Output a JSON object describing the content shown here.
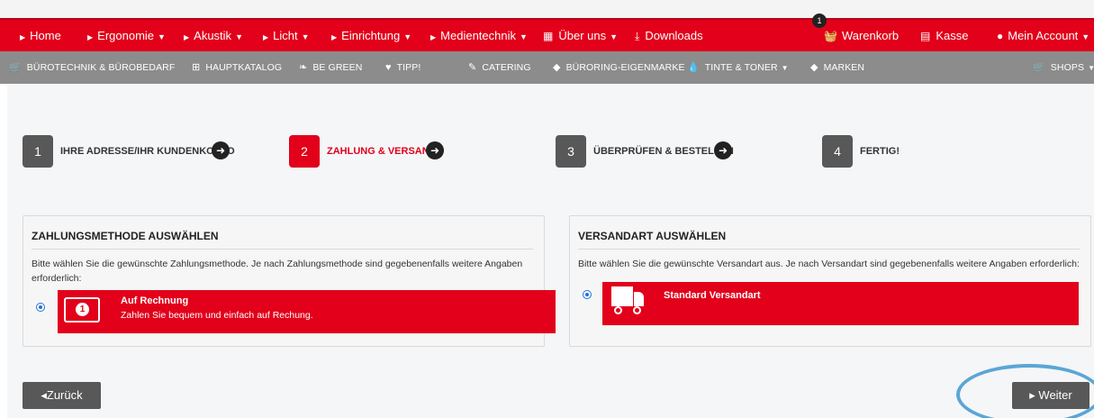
{
  "main_nav": {
    "items": [
      {
        "label": "Home",
        "has_dropdown": false
      },
      {
        "label": "Ergonomie",
        "has_dropdown": true
      },
      {
        "label": "Akustik",
        "has_dropdown": true
      },
      {
        "label": "Licht",
        "has_dropdown": true
      },
      {
        "label": "Einrichtung",
        "has_dropdown": true
      },
      {
        "label": "Medientechnik",
        "has_dropdown": true
      }
    ],
    "ueber_uns": "Über uns",
    "downloads": "Downloads",
    "cart": {
      "label": "Warenkorb",
      "count": "1"
    },
    "checkout": "Kasse",
    "account": "Mein Account"
  },
  "sub_nav": {
    "items": [
      {
        "label": "BÜROTECHNIK & BÜROBEDARF",
        "icon": "cart-icon"
      },
      {
        "label": "HAUPTKATALOG",
        "icon": "sitemap-icon"
      },
      {
        "label": "BE GREEN",
        "icon": "leaf-icon"
      },
      {
        "label": "TIPP!",
        "icon": "heart-icon"
      },
      {
        "label": "CATERING",
        "icon": "utensils-icon"
      },
      {
        "label": "BÜRORING-EIGENMARKE",
        "icon": "tag-icon"
      },
      {
        "label": "TINTE & TONER",
        "icon": "droplet-icon"
      },
      {
        "label": "MARKEN",
        "icon": "tags-icon"
      }
    ],
    "shops": "SHOPS"
  },
  "steps": [
    {
      "number": "1",
      "label": "IHRE ADRESSE/IHR KUNDENKONTO"
    },
    {
      "number": "2",
      "label": "ZAHLUNG & VERSAND",
      "active": true
    },
    {
      "number": "3",
      "label": "ÜBERPRÜFEN & BESTELLEN"
    },
    {
      "number": "4",
      "label": "FERTIG!"
    }
  ],
  "payment": {
    "heading": "ZAHLUNGSMETHODE AUSWÄHLEN",
    "description": "Bitte wählen Sie die gewünschte Zahlungsmethode. Je nach Zahlungsmethode sind gegebenenfalls weitere Angaben erforderlich:",
    "option_title": "Auf Rechnung",
    "option_subtitle": "Zahlen Sie bequem und einfach auf Rechung."
  },
  "shipping": {
    "heading": "VERSANDART AUSWÄHLEN",
    "description": "Bitte wählen Sie die gewünschte Versandart aus. Je nach Versandart sind gegebenenfalls weitere Angaben erforderlich:",
    "option_title": "Standard Versandart"
  },
  "buttons": {
    "back": "◂Zurück",
    "next": "▸ Weiter"
  },
  "colors": {
    "brand_red": "#e2001a",
    "sub_nav_gray": "#8c8c8c",
    "step_gray": "#585858"
  }
}
